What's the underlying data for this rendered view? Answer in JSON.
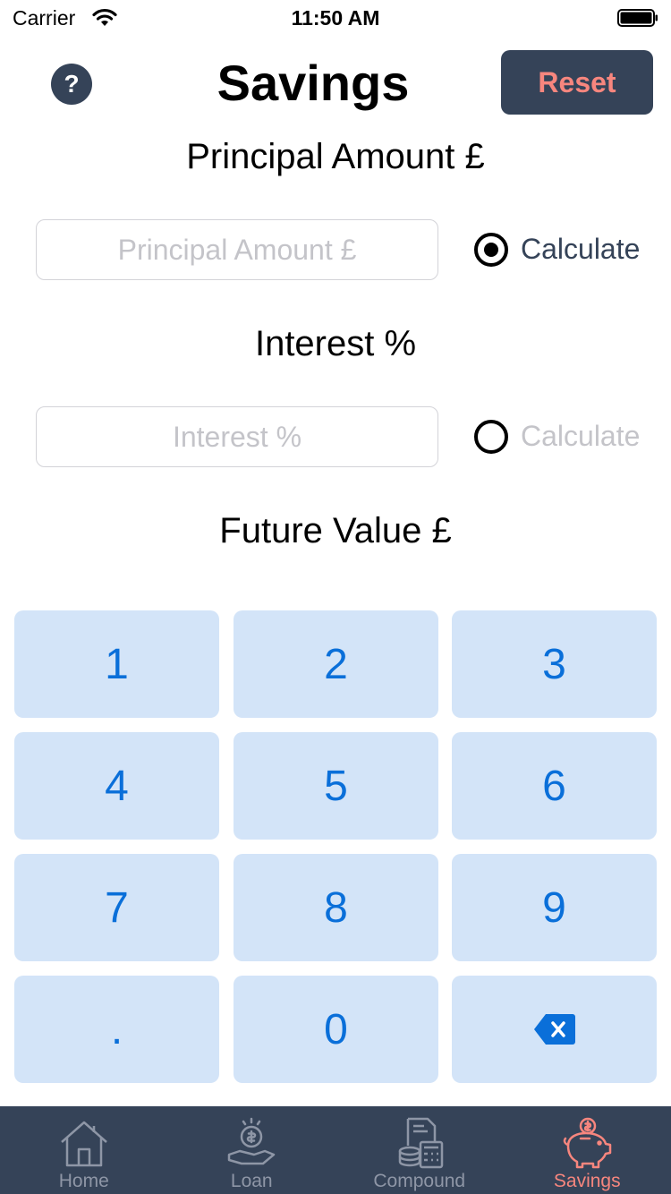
{
  "status_bar": {
    "carrier": "Carrier",
    "time": "11:50 AM"
  },
  "header": {
    "title": "Savings",
    "help_label": "?",
    "reset_label": "Reset"
  },
  "principal": {
    "label": "Principal Amount £",
    "placeholder": "Principal Amount £",
    "calculate_label": "Calculate",
    "calculate_selected": true
  },
  "interest": {
    "label": "Interest %",
    "placeholder": "Interest %",
    "calculate_label": "Calculate",
    "calculate_selected": false
  },
  "future_value": {
    "label": "Future Value £"
  },
  "keypad": {
    "keys": [
      "1",
      "2",
      "3",
      "4",
      "5",
      "6",
      "7",
      "8",
      "9",
      ".",
      "0"
    ],
    "backspace_icon": "backspace-icon"
  },
  "tab_bar": {
    "tabs": [
      {
        "label": "Home",
        "icon": "house-icon",
        "active": false
      },
      {
        "label": "Loan",
        "icon": "hand-coin-icon",
        "active": false
      },
      {
        "label": "Compound",
        "icon": "calculator-document-icon",
        "active": false
      },
      {
        "label": "Savings",
        "icon": "piggy-bank-icon",
        "active": true
      }
    ]
  },
  "colors": {
    "navy": "#354358",
    "accent_red": "#f7867e",
    "key_bg": "#d3e4f8",
    "key_text": "#0a6fd9",
    "tab_inactive": "#8e96a6",
    "placeholder": "#c4c4c9"
  }
}
